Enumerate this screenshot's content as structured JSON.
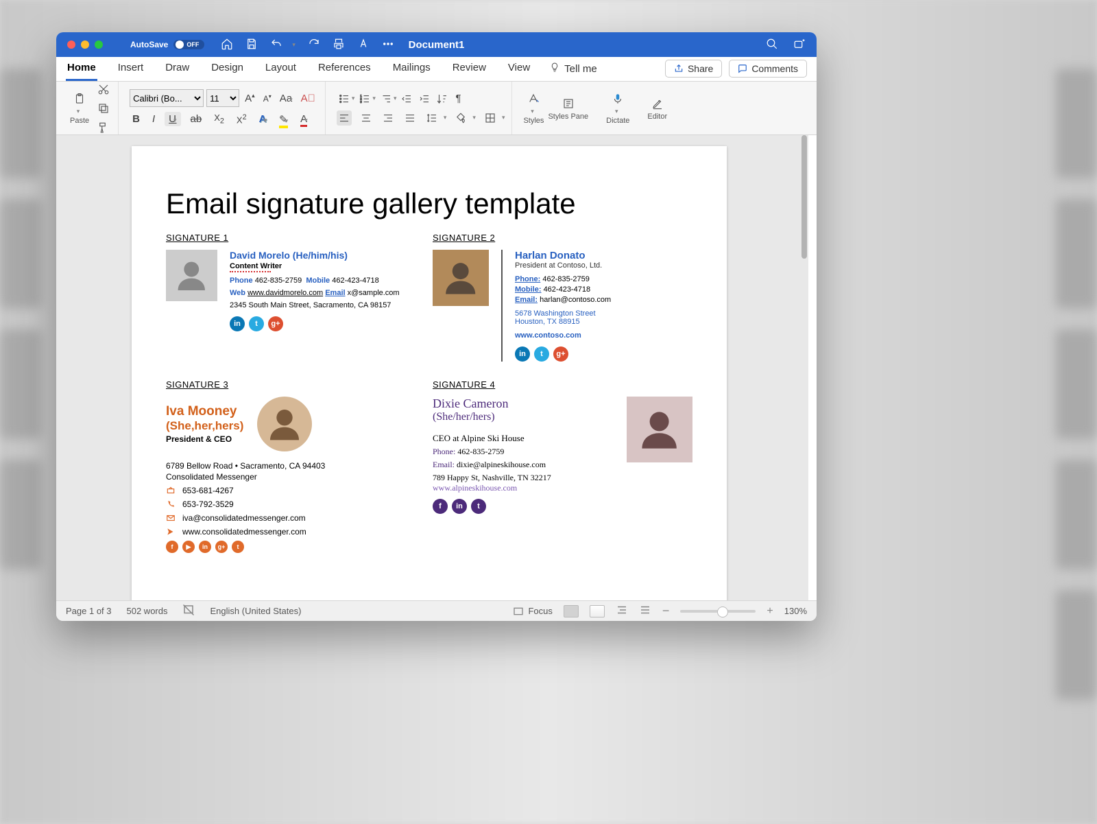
{
  "titlebar": {
    "autosave_label": "AutoSave",
    "autosave_state": "OFF",
    "doc_title": "Document1"
  },
  "tabs": [
    "Home",
    "Insert",
    "Draw",
    "Design",
    "Layout",
    "References",
    "Mailings",
    "Review",
    "View"
  ],
  "tellme": "Tell me",
  "share": "Share",
  "comments": "Comments",
  "ribbon": {
    "paste": "Paste",
    "font_name": "Calibri (Bo...",
    "font_size": "11",
    "styles": "Styles",
    "styles_pane": "Styles Pane",
    "dictate": "Dictate",
    "editor": "Editor"
  },
  "status": {
    "page": "Page 1 of 3",
    "words": "502 words",
    "lang": "English (United States)",
    "focus": "Focus",
    "zoom": "130%"
  },
  "doc": {
    "title": "Email signature gallery template",
    "sig1": {
      "heading": "SIGNATURE 1",
      "name": "David Morelo (He/him/his)",
      "title": "Content Writer",
      "phone_lbl": "Phone",
      "phone": "462-835-2759",
      "mobile_lbl": "Mobile",
      "mobile": "462-423-4718",
      "web_lbl": "Web",
      "web": "www.davidmorelo.com",
      "email_lbl": "Email",
      "email": "x@sample.com",
      "addr": "2345 South Main Street, Sacramento, CA 98157"
    },
    "sig2": {
      "heading": "SIGNATURE 2",
      "name": "Harlan Donato",
      "title": "President at Contoso, Ltd.",
      "phone_lbl": "Phone:",
      "phone": "462-835-2759",
      "mobile_lbl": "Mobile:",
      "mobile": "462-423-4718",
      "email_lbl": "Email:",
      "email": "harlan@contoso.com",
      "addr1": "5678 Washington Street",
      "addr2": "Houston, TX 88915",
      "web": "www.contoso.com"
    },
    "sig3": {
      "heading": "SIGNATURE 3",
      "name": "Iva Mooney",
      "pron": "(She,her,hers)",
      "title": "President & CEO",
      "addr": "6789 Bellow Road • Sacramento, CA 94403",
      "company": "Consolidated Messenger",
      "tel1": "653-681-4267",
      "tel2": "653-792-3529",
      "email": "iva@consolidatedmessenger.com",
      "web": "www.consolidatedmessenger.com"
    },
    "sig4": {
      "heading": "SIGNATURE 4",
      "name": "Dixie Cameron",
      "pron": "(She/her/hers)",
      "title": "CEO at Alpine Ski House",
      "phone_lbl": "Phone:",
      "phone": "462-835-2759",
      "email_lbl": "Email:",
      "email": "dixie@alpineskihouse.com",
      "addr": "789 Happy St, Nashville, TN 32217",
      "web": "www.alpineskihouse.com"
    }
  }
}
